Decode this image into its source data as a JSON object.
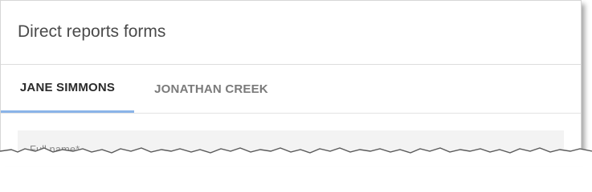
{
  "dialog": {
    "title": "Direct reports forms"
  },
  "tabs": [
    {
      "label": "JANE SIMMONS",
      "active": true
    },
    {
      "label": "JONATHAN CREEK",
      "active": false
    }
  ],
  "form": {
    "full_name_label": "Full name*"
  },
  "colors": {
    "active_tab_indicator": "#8ab4e8",
    "title_text": "#4a4a4a",
    "inactive_tab_text": "#7a7a7a"
  }
}
